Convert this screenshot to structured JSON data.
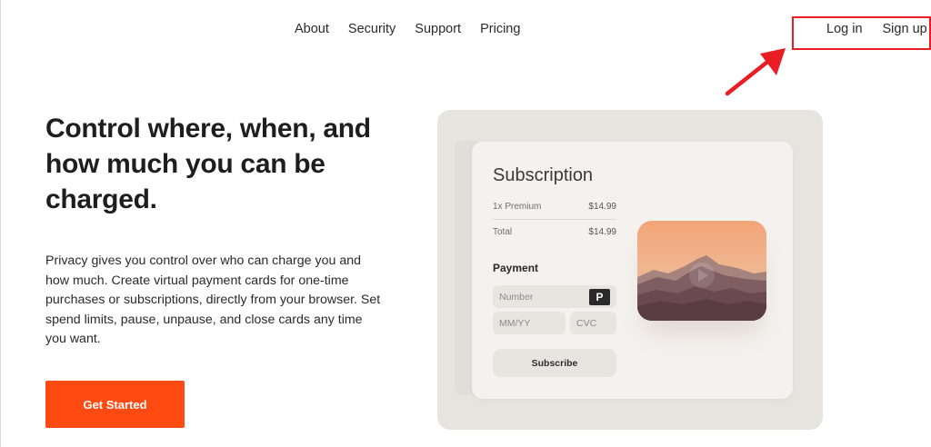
{
  "nav": {
    "links": [
      "About",
      "Security",
      "Support",
      "Pricing"
    ],
    "login": "Log in",
    "signup": "Sign up"
  },
  "hero": {
    "headline": "Control where, when, and how much you can be charged.",
    "description": "Privacy gives you control over who can charge you and how much. Create virtual payment cards for one-time purchases or subscriptions, directly from your browser. Set spend limits, pause, unpause, and close cards any time you want.",
    "cta": "Get Started"
  },
  "illustration": {
    "title": "Subscription",
    "line_item_label": "1x Premium",
    "line_item_amount": "$14.99",
    "total_label": "Total",
    "total_amount": "$14.99",
    "payment_title": "Payment",
    "number_placeholder": "Number",
    "badge": "P",
    "expiry_placeholder": "MM/YY",
    "cvc_placeholder": "CVC",
    "subscribe": "Subscribe"
  },
  "colors": {
    "accent": "#ff4a12",
    "highlight": "#ea1c24"
  }
}
